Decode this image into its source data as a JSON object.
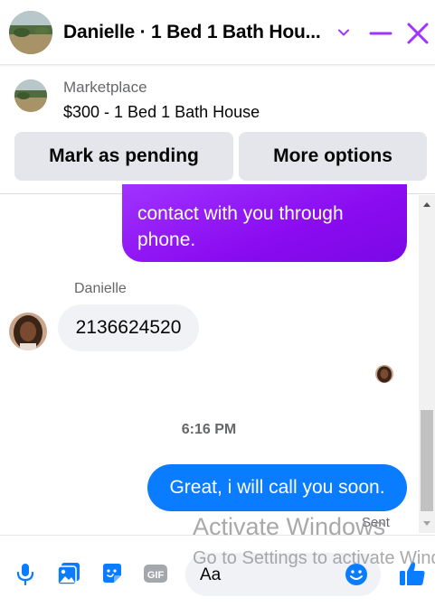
{
  "header": {
    "title": "Danielle · 1 Bed 1 Bath Hou...",
    "avatar_icon": "landscape-avatar",
    "controls": [
      "chevron-down-icon",
      "minimize-icon",
      "close-icon"
    ],
    "accent_color": "#a033ff"
  },
  "marketplace": {
    "label": "Marketplace",
    "listing": "$300 - 1 Bed 1 Bath House",
    "buttons": {
      "pending": "Mark as pending",
      "more": "More options"
    }
  },
  "messages": {
    "outgoing_partial": "contact with you through phone.",
    "sender_name": "Danielle",
    "incoming": "2136624520",
    "timestamp": "6:16 PM",
    "outgoing_last": "Great, i will call you soon.",
    "status": "Sent",
    "colors": {
      "purple": "#8a0bf0",
      "blue": "#0a7cff",
      "gray": "#f0f2f5"
    }
  },
  "composer": {
    "placeholder": "Aa",
    "icons": [
      "microphone-icon",
      "image-icon",
      "sticker-icon",
      "gif-icon",
      "emoji-icon",
      "like-icon"
    ],
    "gif_label": "GIF",
    "accent_color": "#0a7cff"
  },
  "watermark": {
    "title": "Activate Windows",
    "subtitle": "Go to Settings to activate Windows."
  }
}
